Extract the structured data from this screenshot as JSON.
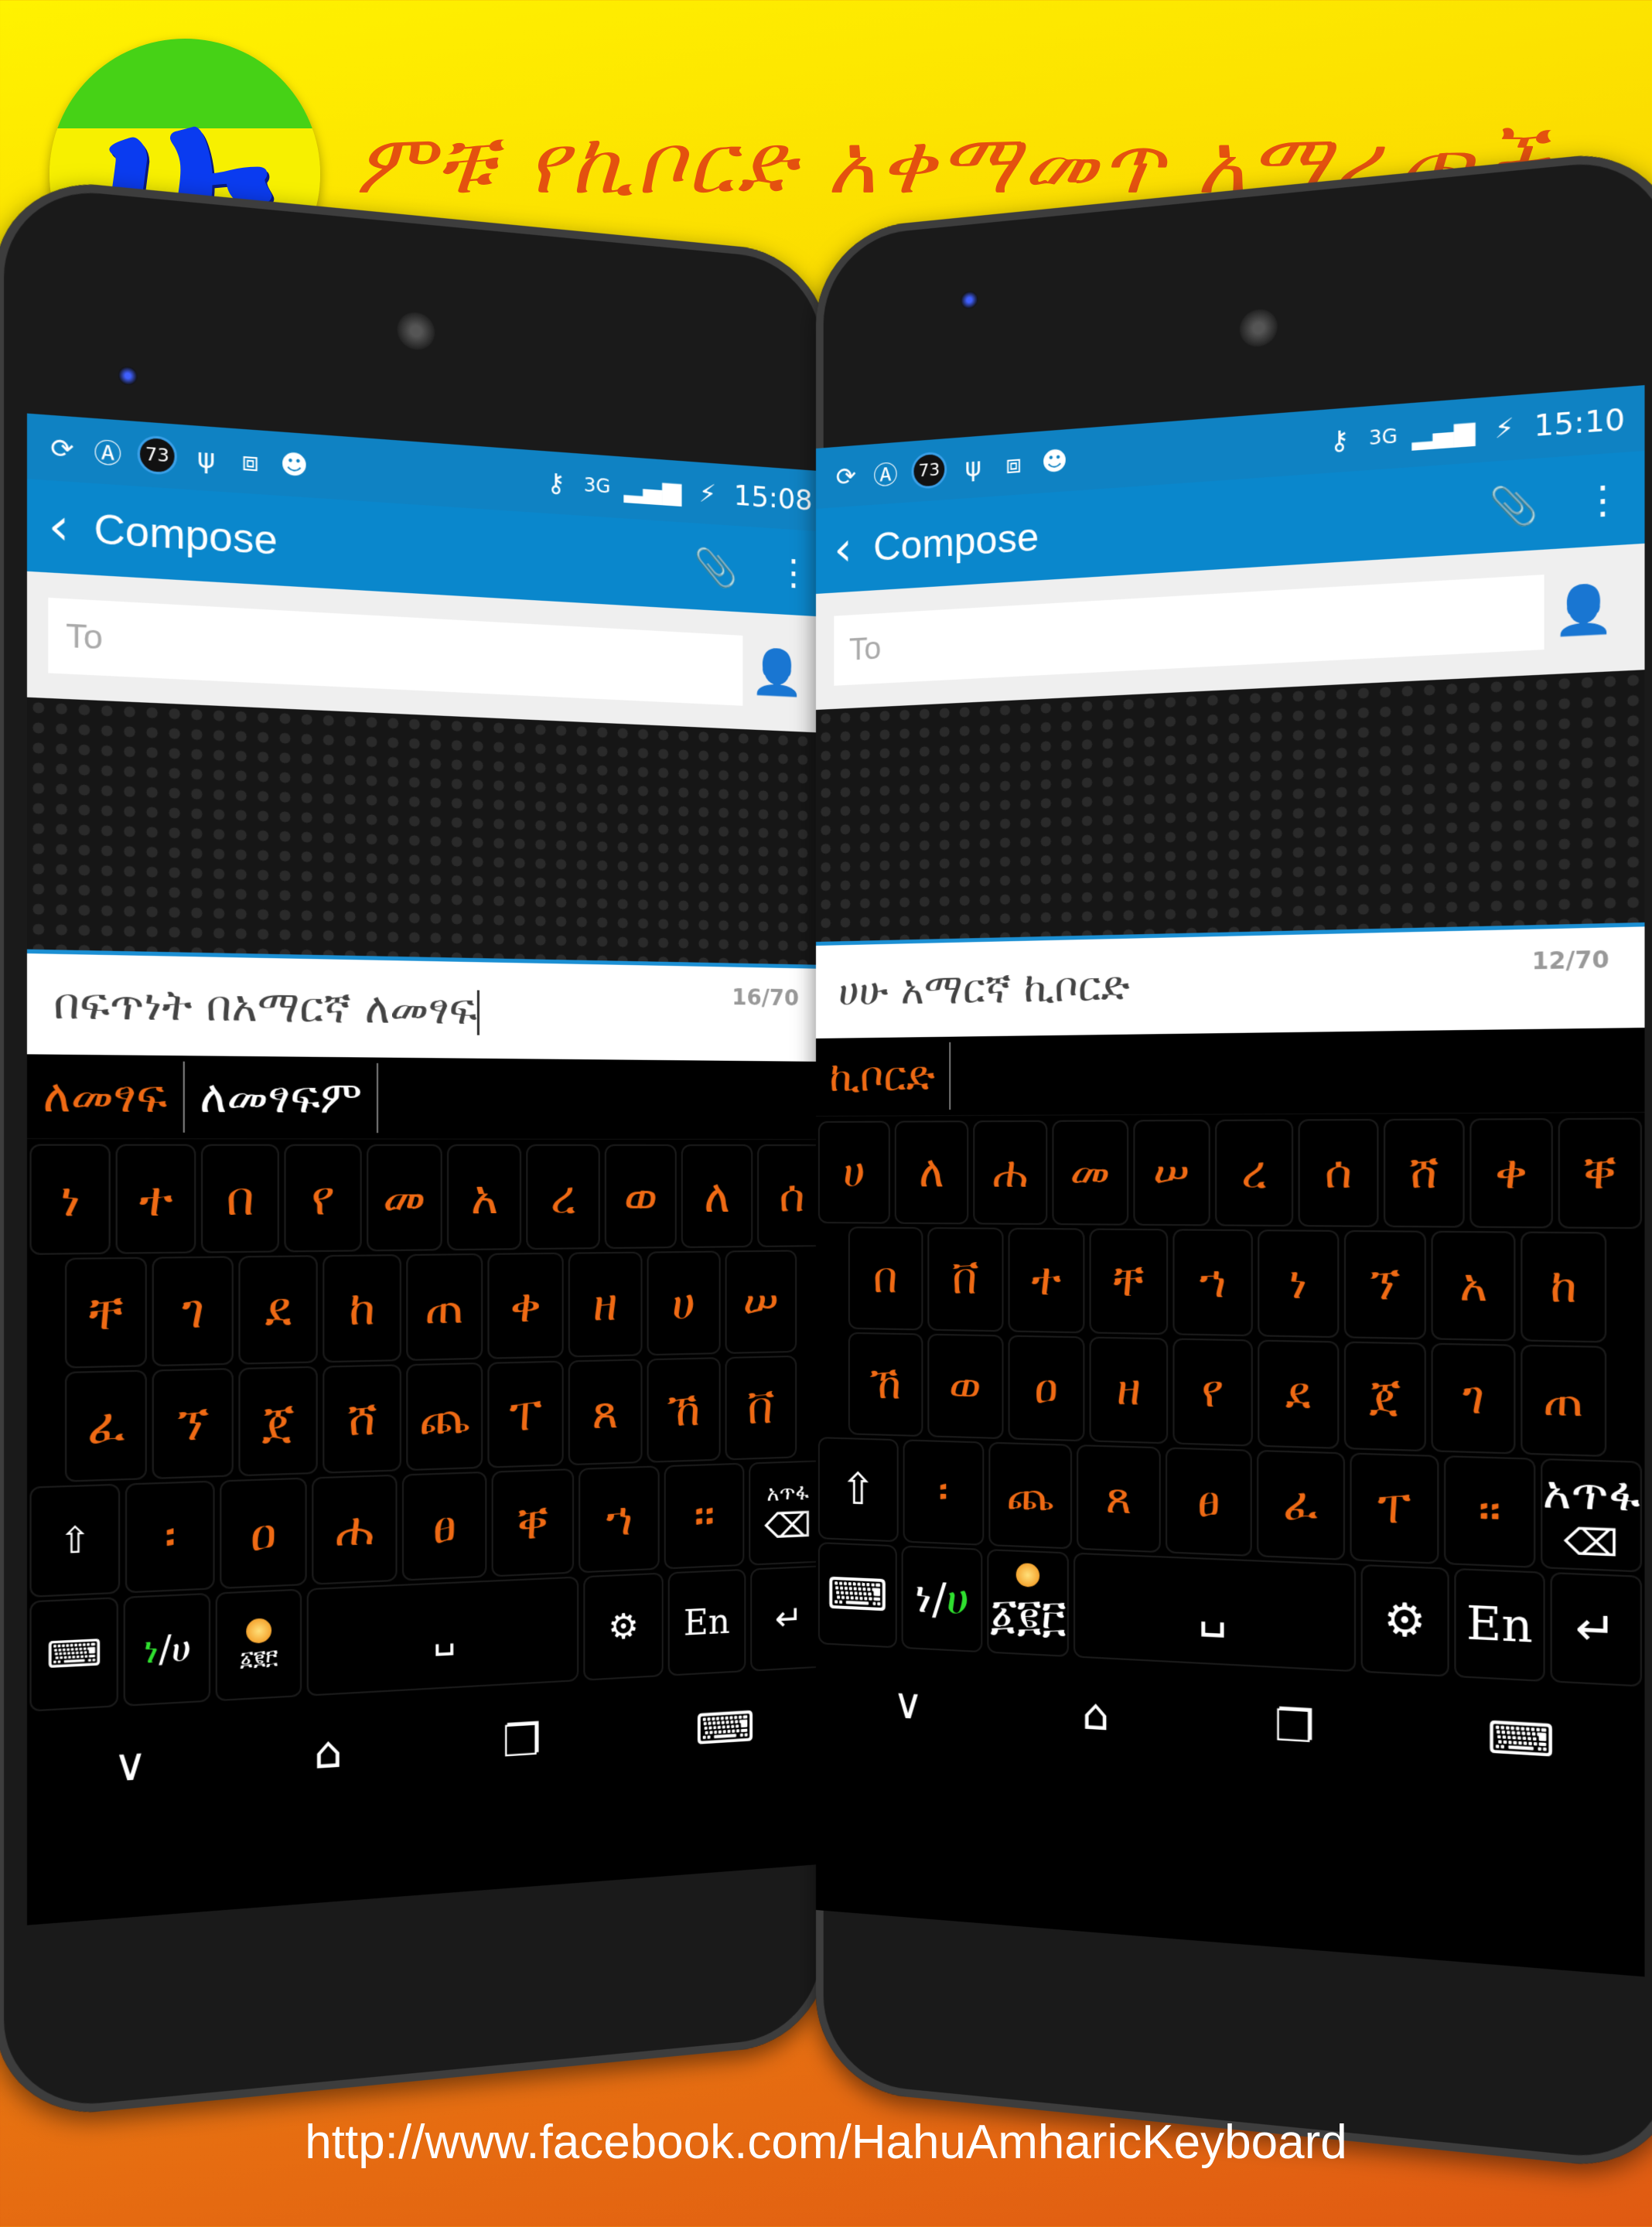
{
  "header": {
    "logo_glyph": "ሁ",
    "title": "ምቹ የኪቦርድ አቀማመጥ አማራጮች"
  },
  "footer": {
    "url": "http://www.facebook.com/HahuAmharicKeyboard"
  },
  "colors": {
    "accent_orange": "#ef6a14",
    "title_orange": "#e4510f",
    "appbar_blue": "#0a87cc",
    "statusbar_blue": "#0f82c3",
    "toggle_green": "#2fe02f"
  },
  "phones": [
    {
      "status": {
        "left_icons": [
          "sync-icon",
          "arc-icon",
          "battery-percent-badge",
          "usb-icon",
          "developer-icon",
          "android-icon"
        ],
        "battery_badge": "73",
        "right_icons": [
          "vpn-key-icon",
          "3g-data-icon",
          "signal-icon",
          "battery-charging-icon"
        ],
        "network": "3G",
        "time": "15:08"
      },
      "appbar": {
        "back": "‹",
        "title": "Compose",
        "attach": "📎",
        "menu": "⋮"
      },
      "to_placeholder": "To",
      "message": {
        "text": "በፍጥነት በአማርኛ ለመፃፍ",
        "counter": "16/70"
      },
      "suggestions": [
        "ለመፃፍ",
        "ለመፃፍም"
      ],
      "keys": {
        "row1": [
          "ነ",
          "ተ",
          "በ",
          "የ",
          "መ",
          "አ",
          "ረ",
          "ወ",
          "ለ",
          "ሰ"
        ],
        "row2": [
          "ቸ",
          "ገ",
          "ደ",
          "ከ",
          "ጠ",
          "ቀ",
          "ዘ",
          "ሀ",
          "ሠ"
        ],
        "row3": [
          "ፈ",
          "ኘ",
          "ጀ",
          "ሸ",
          "ጨ",
          "ፐ",
          "ጸ",
          "ኸ",
          "ቨ"
        ],
        "row4": [
          "፡",
          "ዐ",
          "ሐ",
          "ፀ",
          "ቐ",
          "ኀ",
          "።"
        ],
        "shift": "⇧",
        "backspace_label": "አጥፋ",
        "backspace_icon": "⌫",
        "hide_keyboard": "⌨",
        "toggle_left": "ነ",
        "toggle_slash": "/",
        "toggle_right": "ሀ",
        "numbers_label": "፩፪፫",
        "space": "␣",
        "settings": "⚙",
        "lang": "En",
        "enter": "↵"
      },
      "nav": {
        "back": "∨",
        "home": "⌂",
        "recents": "❐",
        "ime": "⌨"
      }
    },
    {
      "status": {
        "left_icons": [
          "sync-icon",
          "arc-icon",
          "battery-percent-badge",
          "usb-icon",
          "developer-icon",
          "android-icon"
        ],
        "battery_badge": "73",
        "right_icons": [
          "vpn-key-icon",
          "3g-data-icon",
          "signal-icon",
          "battery-charging-icon"
        ],
        "network": "3G",
        "time": "15:10"
      },
      "appbar": {
        "back": "‹",
        "title": "Compose",
        "attach": "📎",
        "menu": "⋮"
      },
      "to_placeholder": "To",
      "message": {
        "text": "ሀሁ አማርኛ ኪቦርድ",
        "counter": "12/70"
      },
      "suggestions": [
        "ኪቦርድ"
      ],
      "keys": {
        "row1": [
          "ሀ",
          "ለ",
          "ሐ",
          "መ",
          "ሠ",
          "ረ",
          "ሰ",
          "ሸ",
          "ቀ",
          "ቐ"
        ],
        "row2": [
          "በ",
          "ቨ",
          "ተ",
          "ቸ",
          "ኀ",
          "ነ",
          "ኘ",
          "አ",
          "ከ"
        ],
        "row3": [
          "ኸ",
          "ወ",
          "ዐ",
          "ዘ",
          "የ",
          "ደ",
          "ጀ",
          "ገ",
          "ጠ"
        ],
        "row4": [
          "፡",
          "ጨ",
          "ጸ",
          "ፀ",
          "ፈ",
          "ፐ",
          "።"
        ],
        "shift": "⇧",
        "backspace_label": "አጥፋ",
        "backspace_icon": "⌫",
        "hide_keyboard": "⌨",
        "toggle_left": "ነ",
        "toggle_slash": "/",
        "toggle_right": "ሀ",
        "numbers_label": "፩፪፫",
        "space": "␣",
        "settings": "⚙",
        "lang": "En",
        "enter": "↵"
      },
      "nav": {
        "back": "∨",
        "home": "⌂",
        "recents": "❐",
        "ime": "⌨"
      }
    }
  ]
}
